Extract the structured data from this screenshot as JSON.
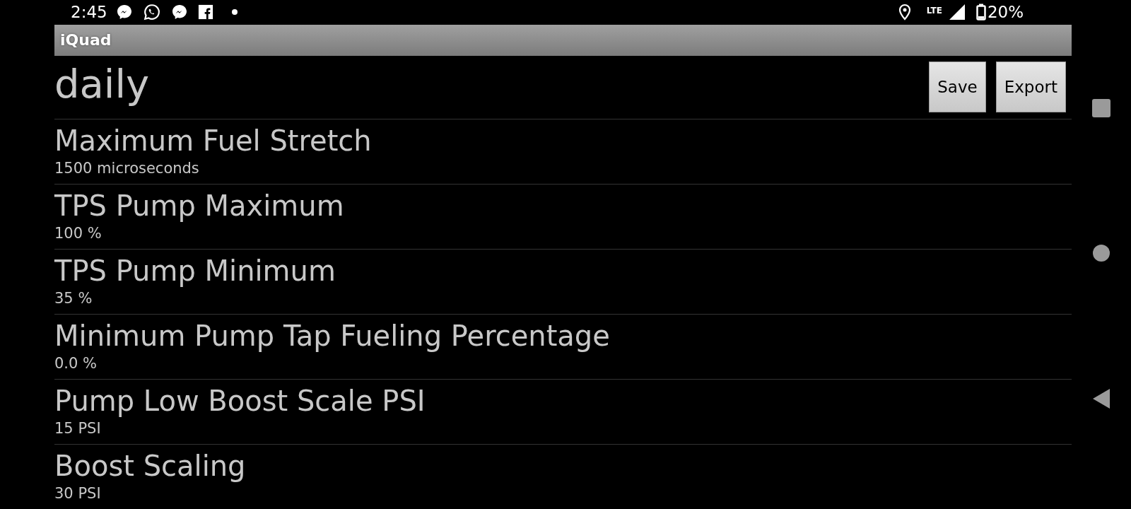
{
  "status_bar": {
    "time": "2:45",
    "network": "LTE",
    "battery": "20%"
  },
  "app_bar": {
    "title": "iQuad"
  },
  "header": {
    "title": "daily",
    "buttons": [
      "Save",
      "Export"
    ]
  },
  "settings": [
    {
      "title": "Maximum Fuel Stretch",
      "value": "1500 microseconds"
    },
    {
      "title": "TPS Pump Maximum",
      "value": "100 %"
    },
    {
      "title": "TPS Pump Minimum",
      "value": "35 %"
    },
    {
      "title": "Minimum Pump Tap Fueling Percentage",
      "value": "0.0 %"
    },
    {
      "title": "Pump Low Boost Scale PSI",
      "value": "15 PSI"
    },
    {
      "title": "Boost Scaling",
      "value": "30 PSI"
    }
  ]
}
